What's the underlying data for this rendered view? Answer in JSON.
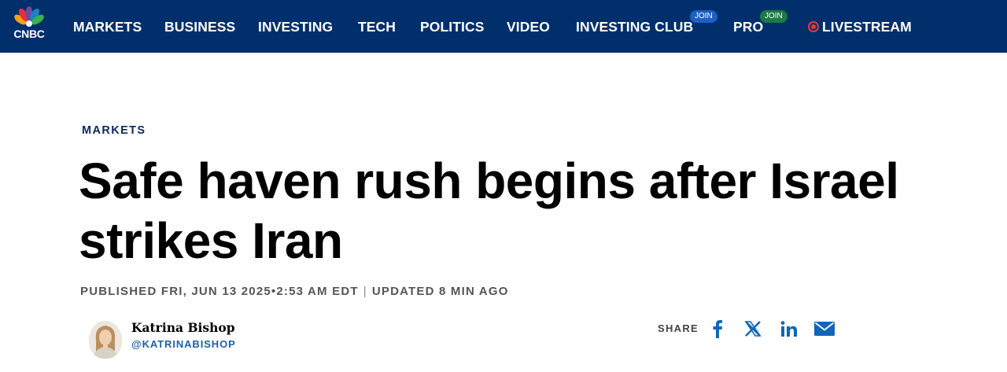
{
  "brand": {
    "name": "CNBC"
  },
  "nav": {
    "items": [
      {
        "label": "MARKETS"
      },
      {
        "label": "BUSINESS"
      },
      {
        "label": "INVESTING"
      },
      {
        "label": "TECH"
      },
      {
        "label": "POLITICS"
      },
      {
        "label": "VIDEO"
      },
      {
        "label": "INVESTING CLUB",
        "badge": "JOIN"
      },
      {
        "label": "PRO",
        "badge": "JOIN"
      }
    ],
    "livestream": "LIVESTREAM"
  },
  "article": {
    "section": "MARKETS",
    "headline": "Safe haven rush begins after Israel strikes Iran",
    "published": "PUBLISHED FRI, JUN 13 2025•2:53 AM EDT",
    "separator": "|",
    "updated": "UPDATED 8 MIN AGO",
    "author": {
      "name": "Katrina Bishop",
      "handle": "@KATRINABISHOP"
    }
  },
  "share": {
    "label": "SHARE",
    "icons": [
      "facebook-icon",
      "x-icon",
      "linkedin-icon",
      "email-icon"
    ]
  },
  "colors": {
    "nav_bg": "#002f6c",
    "section": "#0c2a5c",
    "handle": "#1f5fa8",
    "share_icon": "#0e66b8",
    "live": "#e23b3b"
  }
}
